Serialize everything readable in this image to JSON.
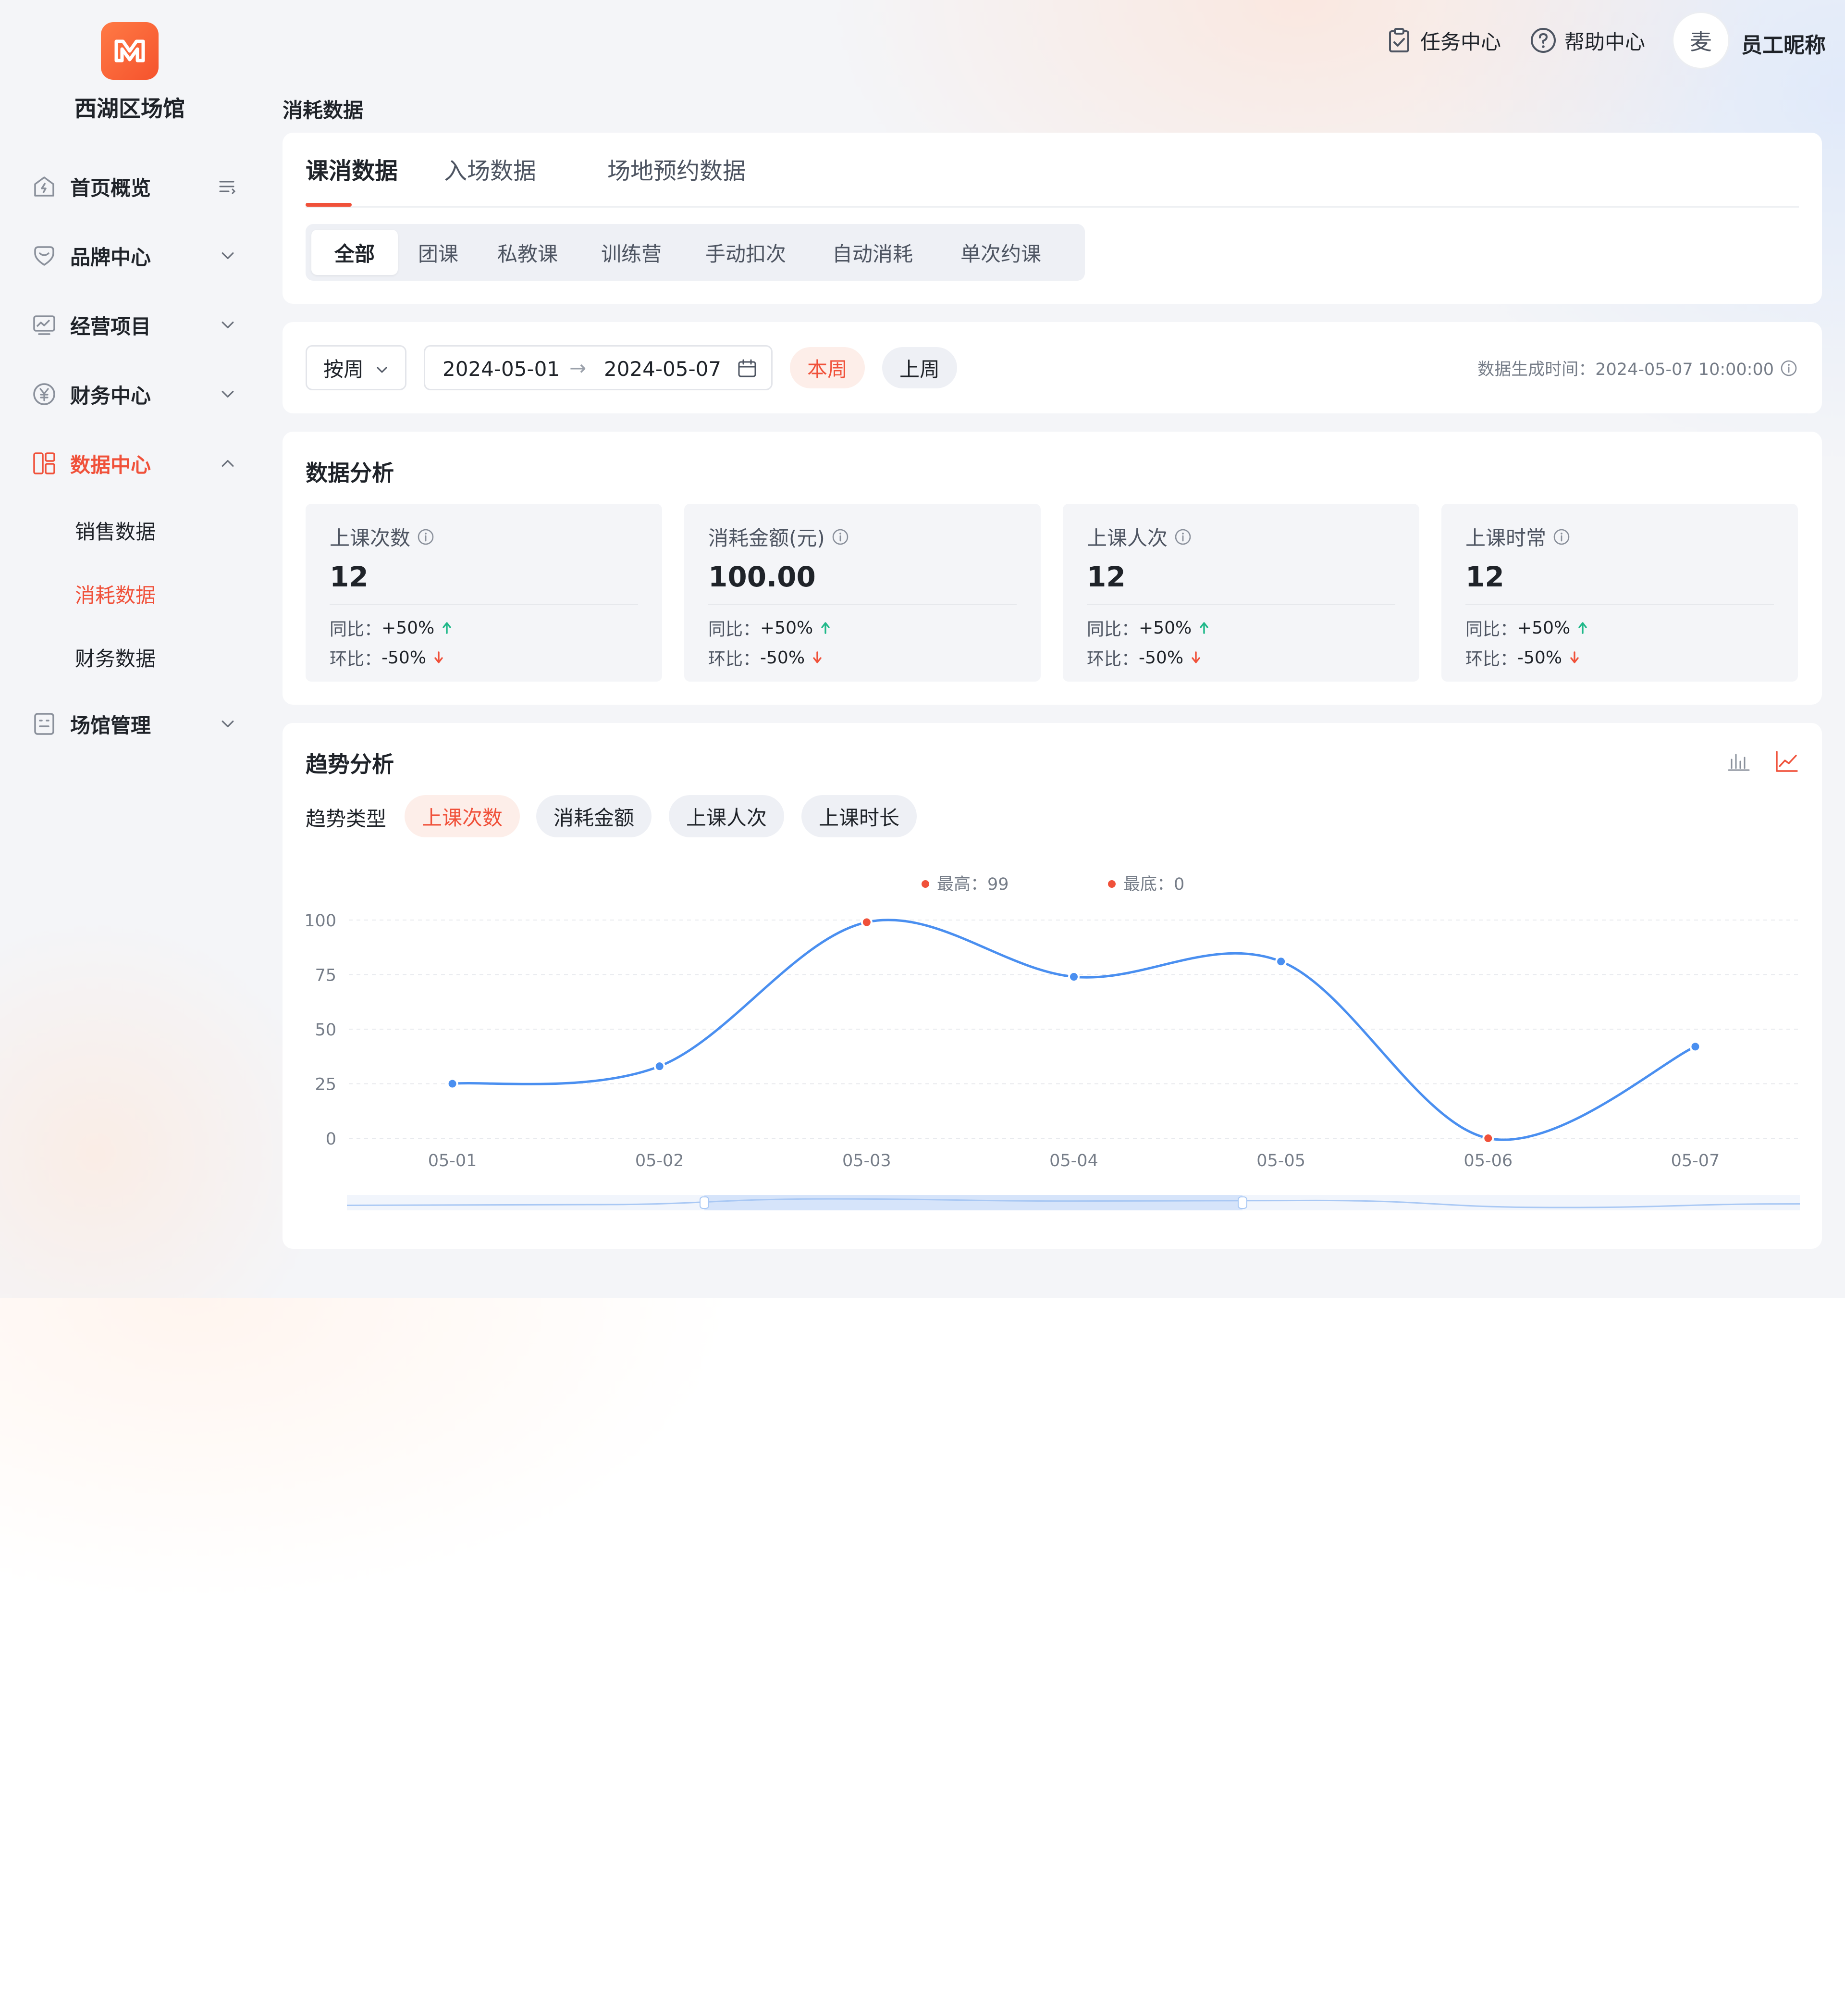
{
  "sidebar": {
    "venue_name": "西湖区场馆",
    "items": [
      {
        "label": "首页概览"
      },
      {
        "label": "品牌中心"
      },
      {
        "label": "经营项目"
      },
      {
        "label": "财务中心"
      },
      {
        "label": "数据中心"
      },
      {
        "label": "场馆管理"
      }
    ],
    "data_center_sub": [
      {
        "label": "销售数据"
      },
      {
        "label": "消耗数据"
      },
      {
        "label": "财务数据"
      }
    ]
  },
  "header": {
    "task_center": "任务中心",
    "help_center": "帮助中心",
    "avatar_char": "麦",
    "username": "员工昵称"
  },
  "page_title": "消耗数据",
  "tabs": [
    {
      "label": "课消数据"
    },
    {
      "label": "入场数据"
    },
    {
      "label": "场地预约数据"
    }
  ],
  "segments": [
    {
      "label": "全部"
    },
    {
      "label": "团课"
    },
    {
      "label": "私教课"
    },
    {
      "label": "训练营"
    },
    {
      "label": "手动扣次"
    },
    {
      "label": "自动消耗"
    },
    {
      "label": "单次约课"
    }
  ],
  "filters": {
    "period_select": "按周",
    "date_start": "2024-05-01",
    "date_arrow": "→",
    "date_end": "2024-05-07",
    "this_week": "本周",
    "last_week": "上周",
    "generated_time": "数据生成时间：2024-05-07 10:00:00"
  },
  "analysis": {
    "title": "数据分析",
    "cards": [
      {
        "label": "上课次数",
        "value": "12",
        "yoy_label": "同比：",
        "yoy": "+50%",
        "mom_label": "环比：",
        "mom": "-50%"
      },
      {
        "label": "消耗金额(元)",
        "value": "100.00",
        "yoy_label": "同比：",
        "yoy": "+50%",
        "mom_label": "环比：",
        "mom": "-50%"
      },
      {
        "label": "上课人次",
        "value": "12",
        "yoy_label": "同比：",
        "yoy": "+50%",
        "mom_label": "环比：",
        "mom": "-50%"
      },
      {
        "label": "上课时常",
        "value": "12",
        "yoy_label": "同比：",
        "yoy": "+50%",
        "mom_label": "环比：",
        "mom": "-50%"
      }
    ]
  },
  "trend": {
    "title": "趋势分析",
    "type_label": "趋势类型",
    "types": [
      {
        "label": "上课次数"
      },
      {
        "label": "消耗金额"
      },
      {
        "label": "上课人次"
      },
      {
        "label": "上课时长"
      }
    ],
    "view_icons": [
      "bar-chart-icon",
      "line-chart-icon"
    ]
  },
  "chart_data": {
    "type": "line",
    "categories": [
      "05-01",
      "05-02",
      "05-03",
      "05-04",
      "05-05",
      "05-06",
      "05-07"
    ],
    "series": [
      {
        "values": [
          25,
          33,
          99,
          74,
          81,
          0,
          42
        ]
      }
    ],
    "ylim": [
      0,
      100
    ],
    "yticks": [
      0,
      25,
      50,
      75,
      100
    ],
    "legend": {
      "max_label": "最高：99",
      "min_label": "最底：0"
    },
    "grid": true,
    "smooth": true,
    "colors": {
      "line": "#4a8ff0",
      "extreme_point": "#f0513a",
      "accent": "#f0513a"
    }
  }
}
